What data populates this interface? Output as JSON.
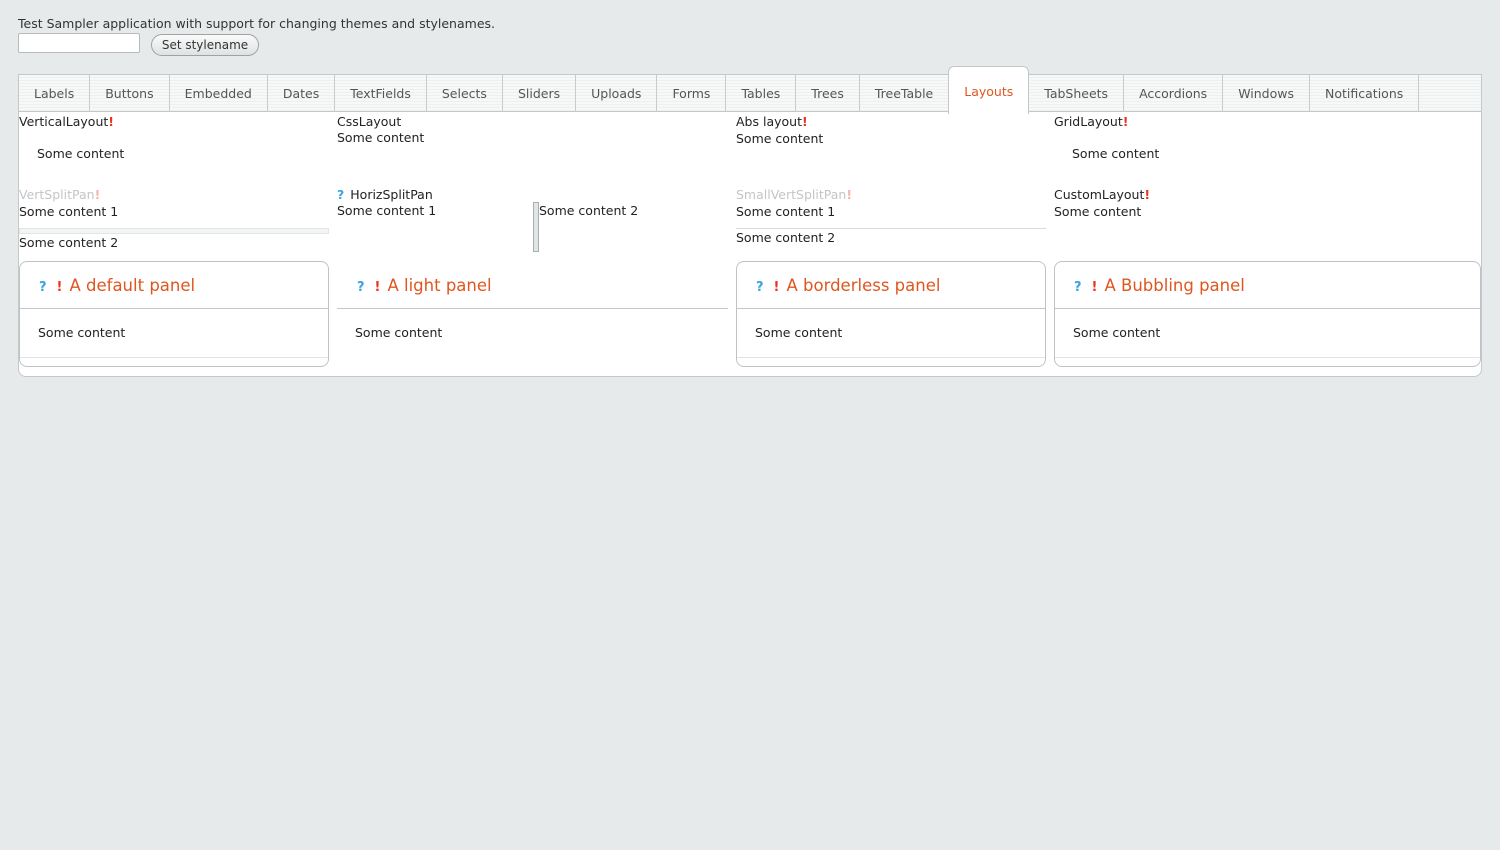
{
  "app": {
    "intro": "Test Sampler application with support for changing themes and stylenames.",
    "stylename_placeholder": "",
    "set_stylename_label": "Set stylename"
  },
  "tabs": [
    {
      "label": "Labels"
    },
    {
      "label": "Buttons"
    },
    {
      "label": "Embedded"
    },
    {
      "label": "Dates"
    },
    {
      "label": "TextFields"
    },
    {
      "label": "Selects"
    },
    {
      "label": "Sliders"
    },
    {
      "label": "Uploads"
    },
    {
      "label": "Forms"
    },
    {
      "label": "Tables"
    },
    {
      "label": "Trees"
    },
    {
      "label": "TreeTable"
    },
    {
      "label": "Layouts"
    },
    {
      "label": "TabSheets"
    },
    {
      "label": "Accordions"
    },
    {
      "label": "Windows"
    },
    {
      "label": "Notifications"
    }
  ],
  "selected_tab": "Layouts",
  "icons": {
    "warning": "!",
    "help": "?"
  },
  "layouts": {
    "vertical": {
      "caption": "VerticalLayout",
      "content": "Some content"
    },
    "css": {
      "caption": "CssLayout",
      "content": "Some content"
    },
    "abs": {
      "caption": "Abs layout",
      "content": "Some content"
    },
    "grid": {
      "caption": "GridLayout",
      "content": "Some content"
    },
    "vert_split": {
      "caption": "VertSplitPan",
      "content1": "Some content 1",
      "content2": "Some content 2"
    },
    "horiz_split": {
      "caption": "HorizSplitPan",
      "content1": "Some content 1",
      "content2": "Some content 2"
    },
    "small_vert_split": {
      "caption": "SmallVertSplitPan",
      "content1": "Some content 1",
      "content2": "Some content 2"
    },
    "custom": {
      "caption": "CustomLayout",
      "content": "Some content"
    }
  },
  "panels": {
    "default": {
      "title": "A default panel",
      "content": "Some content"
    },
    "light": {
      "title": "A light panel",
      "content": "Some content"
    },
    "borderless": {
      "title": "A borderless panel",
      "content": "Some content"
    },
    "bubbling": {
      "title": "A Bubbling panel",
      "content": "Some content"
    }
  },
  "colors": {
    "accent": "#e0561f",
    "warning": "#e8341c",
    "help": "#3aa3dd",
    "background": "#e7eaeb"
  }
}
